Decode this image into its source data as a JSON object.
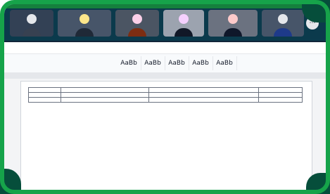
{
  "meeting": {
    "participants": [
      {
        "name": "",
        "avatar_color": "#e5e7eb",
        "body_color": "#374151",
        "bg": "#334155"
      },
      {
        "name": "",
        "avatar_color": "#fde68a",
        "body_color": "#1f2937",
        "bg": "#475569"
      },
      {
        "name": "",
        "avatar_color": "#fbcfe8",
        "body_color": "#7c2d12",
        "bg": "#4b5563"
      },
      {
        "name": "",
        "avatar_color": "#f5d0fe",
        "body_color": "#111827",
        "bg": "#9ca3af"
      },
      {
        "name": "",
        "avatar_color": "#fecaca",
        "body_color": "#0f172a",
        "bg": "#6b7280"
      },
      {
        "name": "",
        "avatar_color": "#e5e7eb",
        "body_color": "#1e3a8a",
        "bg": "#475569"
      }
    ],
    "more_icon": "⋯"
  },
  "app_menu": {
    "items": [
      "",
      "",
      "",
      "",
      "",
      "",
      "",
      "",
      ""
    ]
  },
  "toolbar": {
    "font_controls": [
      "",
      "",
      ""
    ],
    "styles": [
      {
        "sample": "AaBb",
        "label": ""
      },
      {
        "sample": "AaBb",
        "label": ""
      },
      {
        "sample": "AaBb",
        "label": ""
      },
      {
        "sample": "AaBb",
        "label": ""
      },
      {
        "sample": "AaBb",
        "label": ""
      }
    ]
  },
  "document": {
    "rows": [
      {
        "c1": "",
        "c2": [
          "",
          "",
          "",
          ""
        ],
        "c3": [
          "",
          "",
          "",
          ""
        ],
        "c4": [
          "",
          ""
        ]
      },
      {
        "c1": "",
        "c2": [
          "",
          "",
          ""
        ],
        "c3": [
          "",
          "",
          "",
          ""
        ],
        "c4": [
          "",
          ""
        ]
      },
      {
        "c1": "",
        "c2": [
          ""
        ],
        "c3": [
          "",
          "",
          ""
        ],
        "c4": [
          "",
          ""
        ]
      }
    ]
  }
}
